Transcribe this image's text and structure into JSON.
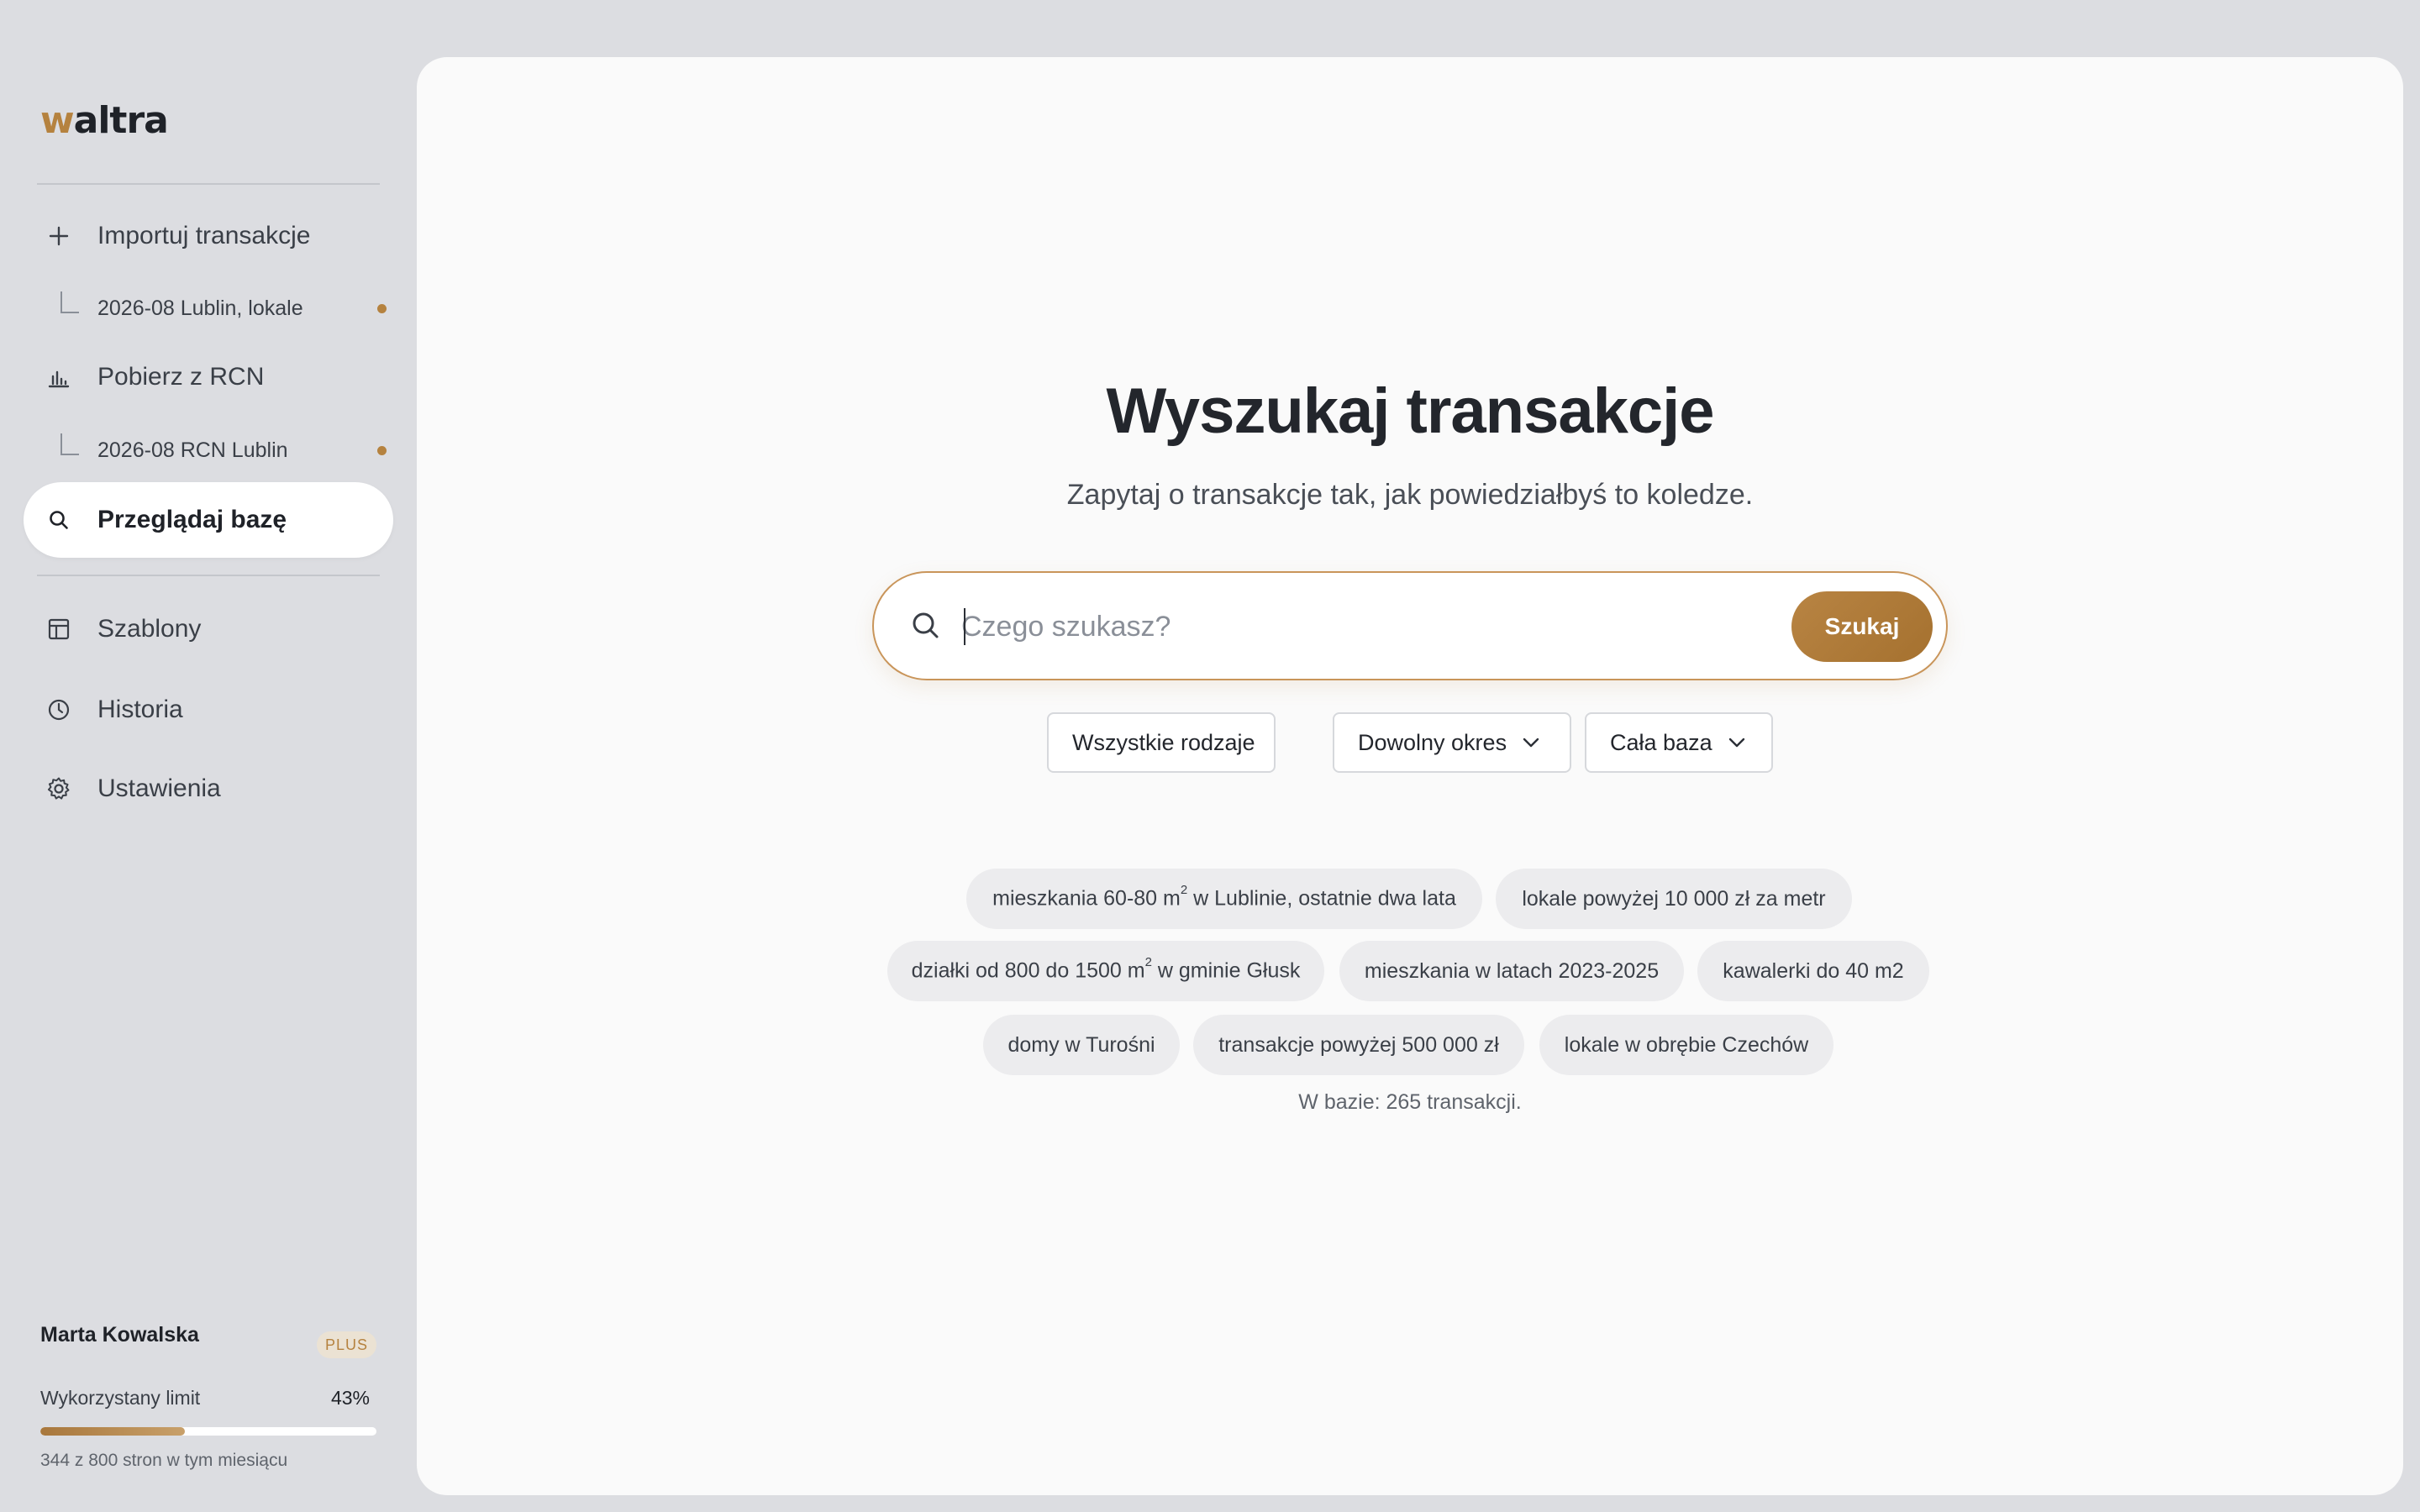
{
  "brand": {
    "logo_first": "w",
    "logo_rest": "altra",
    "accent": "#b5823f"
  },
  "sidebar": {
    "import_label": "Importuj transakcje",
    "import_sub": "2026-08 Lublin, lokale",
    "rcn_label": "Pobierz z RCN",
    "rcn_sub": "2026-08 RCN Lublin",
    "browse_label": "Przeglądaj bazę",
    "templates_label": "Szablony",
    "history_label": "Historia",
    "settings_label": "Ustawienia"
  },
  "user": {
    "name": "Marta Kowalska",
    "plan": "PLUS",
    "limit_label": "Wykorzystany limit",
    "limit_pct": "43%",
    "limit_fraction": 0.43,
    "usage_text": "344 z 800 stron w tym miesiącu"
  },
  "main": {
    "title": "Wyszukaj transakcje",
    "subtitle": "Zapytaj o transakcje tak, jak powiedziałbyś to koledze.",
    "search_placeholder": "Czego szukasz?",
    "search_value": "",
    "search_button": "Szukaj",
    "filters": {
      "type": "Wszystkie rodzaje",
      "period": "Dowolny okres",
      "scope": "Cała baza"
    },
    "suggestions": {
      "s1_a": "mieszkania 60-80 m",
      "s1_sup": "2",
      "s1_b": " w Lublinie, ostatnie dwa lata",
      "s2": "lokale powyżej 10 000 zł za metr",
      "s3_a": "działki od 800 do 1500 m",
      "s3_sup": "2",
      "s3_b": " w gminie Głusk",
      "s4": "mieszkania w latach 2023-2025",
      "s5": "kawalerki do 40 m2",
      "s6": "domy w Turośni",
      "s7": "transakcje powyżej 500 000 zł",
      "s8": "lokale w obrębie Czechów"
    },
    "db_count": "W bazie: 265 transakcji."
  }
}
